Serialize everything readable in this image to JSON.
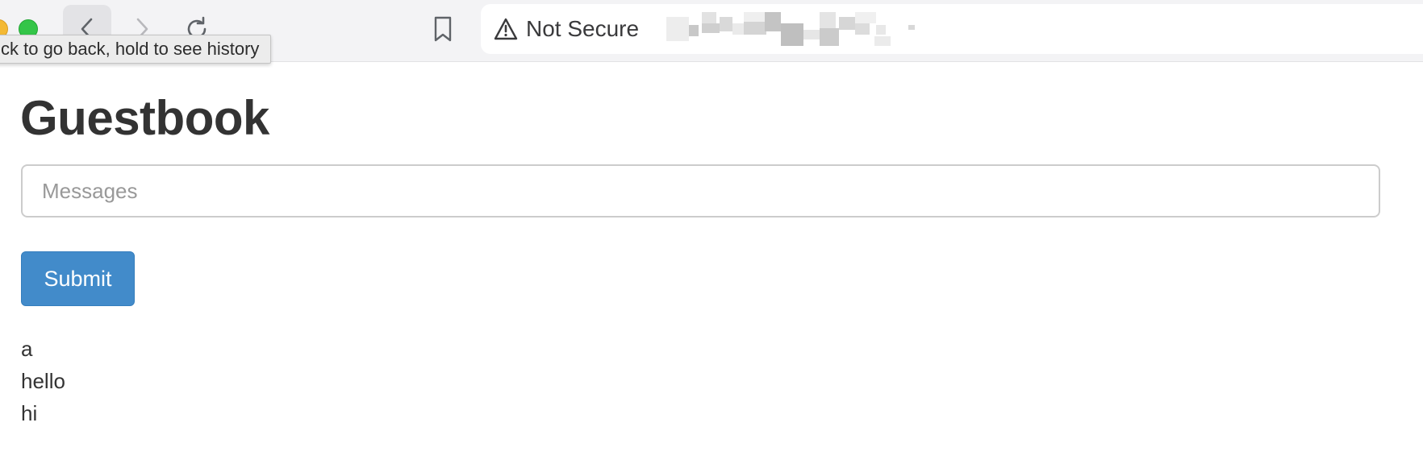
{
  "browser": {
    "tooltip": "ck to go back, hold to see history",
    "security_label": "Not Secure",
    "icons": {
      "back": "chevron-left-icon",
      "forward": "chevron-right-icon",
      "reload": "reload-icon",
      "bookmark": "bookmark-icon",
      "warning": "warning-triangle-icon"
    },
    "colors": {
      "toolbar_bg": "#f3f3f5",
      "traffic_yellow": "#f4b934",
      "traffic_green": "#34c548"
    }
  },
  "page": {
    "title": "Guestbook",
    "input": {
      "value": "",
      "placeholder": "Messages"
    },
    "submit_label": "Submit",
    "messages": [
      "a",
      "hello",
      "hi"
    ],
    "colors": {
      "button_bg": "#428bca",
      "text": "#333333"
    }
  }
}
